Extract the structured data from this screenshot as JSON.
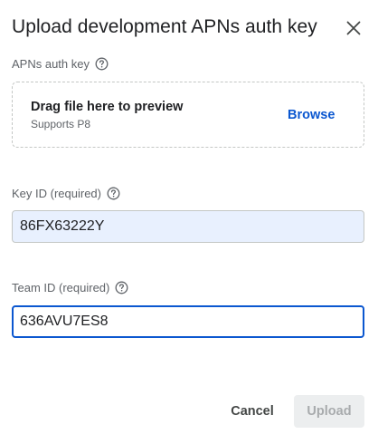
{
  "dialog": {
    "title": "Upload development APNs auth key",
    "close_icon": "close-icon"
  },
  "auth_key": {
    "label": "APNs auth key",
    "help_icon": "help-circle-icon",
    "dropzone": {
      "main_text": "Drag file here to preview",
      "sub_text": "Supports P8",
      "browse_label": "Browse"
    }
  },
  "key_id": {
    "label": "Key ID (required)",
    "help_icon": "help-circle-icon",
    "value": "86FX63222Y"
  },
  "team_id": {
    "label": "Team ID (required)",
    "help_icon": "help-circle-icon",
    "value": "636AVU7ES8"
  },
  "actions": {
    "cancel_label": "Cancel",
    "upload_label": "Upload"
  },
  "colors": {
    "accent": "#0b57d0",
    "autofill_bg": "#e8f0fe",
    "disabled_bg": "#eceeef",
    "disabled_text": "#a8abad"
  }
}
